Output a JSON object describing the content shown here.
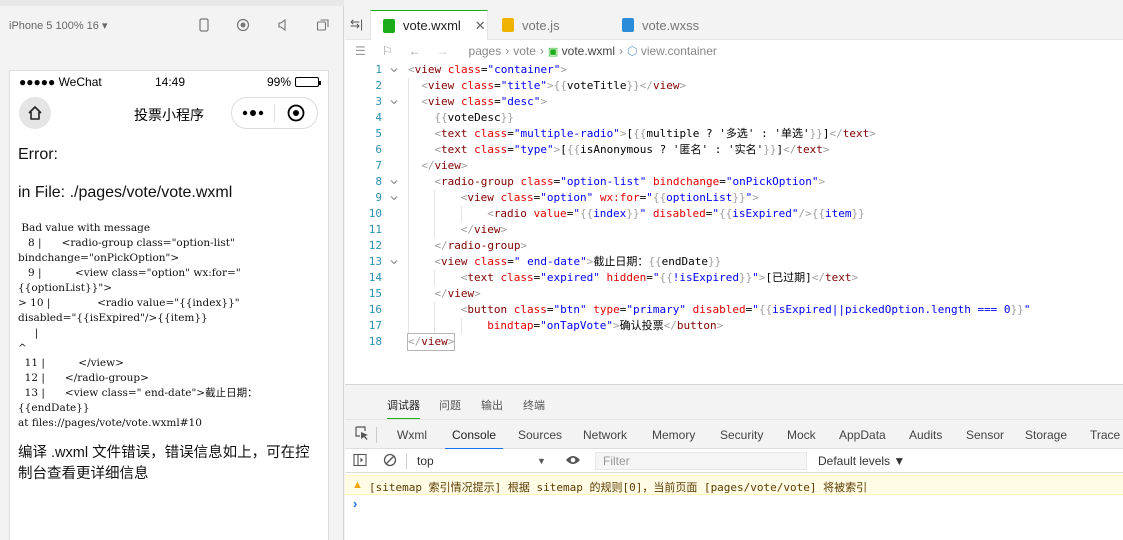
{
  "simulator": {
    "device": "iPhone 5 100% 16 ▾",
    "status": {
      "carrier": "●●●●● WeChat",
      "time": "14:49",
      "battery": "99%",
      "battery_level": 0.99
    },
    "nav_title": "投票小程序",
    "error_title": "Error:",
    "error_file": "in File: ./pages/vote/vote.wxml",
    "error_code": " Bad value with message\n   8 |      <radio-group class=\"option-list\"\nbindchange=\"onPickOption\">\n   9 |          <view class=\"option\" wx:for=\"\n{{optionList}}\">\n> 10 |              <radio value=\"{{index}}\"\ndisabled=\"{{isExpired\"/>{{item}}\n     |\n^\n  11 |          </view>\n  12 |      </radio-group>\n  13 |      <view class=\" end-date\">截止日期：\n{{endDate}}\nat files://pages/vote/vote.wxml#10",
    "error_tip": "编译 .wxml 文件错误，错误信息如上，可在控制台查看更详细信息"
  },
  "editor": {
    "tabs": [
      {
        "label": "vote.wxml",
        "active": true,
        "color": "#1aad19"
      },
      {
        "label": "vote.js",
        "active": false,
        "color": "#f0b400"
      },
      {
        "label": "vote.wxss",
        "active": false,
        "color": "#2b8cd9"
      }
    ],
    "breadcrumb": [
      "pages",
      "vote",
      "vote.wxml",
      "view.container"
    ],
    "lines": [
      {
        "n": "1",
        "fold": true,
        "indent": 0,
        "tokens": [
          [
            "br",
            "<"
          ],
          [
            "tag",
            "view"
          ],
          [
            "t",
            " "
          ],
          [
            "attr",
            "class"
          ],
          [
            "t",
            "="
          ],
          [
            "val",
            "\"container\""
          ],
          [
            "br",
            ">"
          ]
        ]
      },
      {
        "n": "2",
        "fold": false,
        "indent": 1,
        "tokens": [
          [
            "br",
            "<"
          ],
          [
            "tag",
            "view"
          ],
          [
            "t",
            " "
          ],
          [
            "attr",
            "class"
          ],
          [
            "t",
            "="
          ],
          [
            "val",
            "\"title\""
          ],
          [
            "br",
            ">"
          ],
          [
            "br",
            "{{"
          ],
          [
            "t",
            "voteTitle"
          ],
          [
            "br",
            "}}"
          ],
          [
            "br",
            "</"
          ],
          [
            "tag",
            "view"
          ],
          [
            "br",
            ">"
          ]
        ]
      },
      {
        "n": "3",
        "fold": true,
        "indent": 1,
        "tokens": [
          [
            "br",
            "<"
          ],
          [
            "tag",
            "view"
          ],
          [
            "t",
            " "
          ],
          [
            "attr",
            "class"
          ],
          [
            "t",
            "="
          ],
          [
            "val",
            "\"desc\""
          ],
          [
            "br",
            ">"
          ]
        ]
      },
      {
        "n": "4",
        "fold": false,
        "indent": 2,
        "tokens": [
          [
            "br",
            "{{"
          ],
          [
            "t",
            "voteDesc"
          ],
          [
            "br",
            "}}"
          ]
        ]
      },
      {
        "n": "5",
        "fold": false,
        "indent": 2,
        "tokens": [
          [
            "br",
            "<"
          ],
          [
            "tag",
            "text"
          ],
          [
            "t",
            " "
          ],
          [
            "attr",
            "class"
          ],
          [
            "t",
            "="
          ],
          [
            "val",
            "\"multiple-radio\""
          ],
          [
            "br",
            ">"
          ],
          [
            "t",
            "["
          ],
          [
            "br",
            "{{"
          ],
          [
            "t",
            "multiple ? '多选' : '单选'"
          ],
          [
            "br",
            "}}"
          ],
          [
            "t",
            "]"
          ],
          [
            "br",
            "</"
          ],
          [
            "tag",
            "text"
          ],
          [
            "br",
            ">"
          ]
        ]
      },
      {
        "n": "6",
        "fold": false,
        "indent": 2,
        "tokens": [
          [
            "br",
            "<"
          ],
          [
            "tag",
            "text"
          ],
          [
            "t",
            " "
          ],
          [
            "attr",
            "class"
          ],
          [
            "t",
            "="
          ],
          [
            "val",
            "\"type\""
          ],
          [
            "br",
            ">"
          ],
          [
            "t",
            "["
          ],
          [
            "br",
            "{{"
          ],
          [
            "t",
            "isAnonymous ? '匿名' : '实名'"
          ],
          [
            "br",
            "}}"
          ],
          [
            "t",
            "]"
          ],
          [
            "br",
            "</"
          ],
          [
            "tag",
            "text"
          ],
          [
            "br",
            ">"
          ]
        ]
      },
      {
        "n": "7",
        "fold": false,
        "indent": 1,
        "tokens": [
          [
            "br",
            "</"
          ],
          [
            "tag",
            "view"
          ],
          [
            "br",
            ">"
          ]
        ]
      },
      {
        "n": "8",
        "fold": true,
        "indent": 2,
        "tokens": [
          [
            "br",
            "<"
          ],
          [
            "tag",
            "radio-group"
          ],
          [
            "t",
            " "
          ],
          [
            "attr",
            "class"
          ],
          [
            "t",
            "="
          ],
          [
            "val",
            "\"option-list\""
          ],
          [
            "t",
            " "
          ],
          [
            "attr",
            "bindchange"
          ],
          [
            "t",
            "="
          ],
          [
            "val",
            "\"onPickOption\""
          ],
          [
            "br",
            ">"
          ]
        ]
      },
      {
        "n": "9",
        "fold": true,
        "indent": 4,
        "tokens": [
          [
            "br",
            "<"
          ],
          [
            "tag",
            "view"
          ],
          [
            "t",
            " "
          ],
          [
            "attr",
            "class"
          ],
          [
            "t",
            "="
          ],
          [
            "val",
            "\"option\""
          ],
          [
            "t",
            " "
          ],
          [
            "attr",
            "wx:for"
          ],
          [
            "t",
            "="
          ],
          [
            "val",
            "\""
          ],
          [
            "br",
            "{{"
          ],
          [
            "val",
            "optionList"
          ],
          [
            "br",
            "}}"
          ],
          [
            "val",
            "\""
          ],
          [
            "br",
            ">"
          ]
        ]
      },
      {
        "n": "10",
        "fold": false,
        "indent": 6,
        "tokens": [
          [
            "br",
            "<"
          ],
          [
            "tag",
            "radio"
          ],
          [
            "t",
            " "
          ],
          [
            "attr",
            "value"
          ],
          [
            "t",
            "="
          ],
          [
            "val",
            "\""
          ],
          [
            "br",
            "{{"
          ],
          [
            "val",
            "index"
          ],
          [
            "br",
            "}}"
          ],
          [
            "val",
            "\""
          ],
          [
            "t",
            " "
          ],
          [
            "attr",
            "disabled"
          ],
          [
            "t",
            "="
          ],
          [
            "val",
            "\""
          ],
          [
            "br",
            "{{"
          ],
          [
            "val",
            "isExpired"
          ],
          [
            "val",
            "\""
          ],
          [
            "br",
            "/>"
          ],
          [
            "br",
            "{{"
          ],
          [
            "val",
            "item"
          ],
          [
            "br",
            "}}"
          ]
        ]
      },
      {
        "n": "11",
        "fold": false,
        "indent": 4,
        "tokens": [
          [
            "br",
            "</"
          ],
          [
            "tag",
            "view"
          ],
          [
            "br",
            ">"
          ]
        ]
      },
      {
        "n": "12",
        "fold": false,
        "indent": 2,
        "tokens": [
          [
            "br",
            "</"
          ],
          [
            "tag",
            "radio-group"
          ],
          [
            "br",
            ">"
          ]
        ]
      },
      {
        "n": "13",
        "fold": true,
        "indent": 2,
        "tokens": [
          [
            "br",
            "<"
          ],
          [
            "tag",
            "view"
          ],
          [
            "t",
            " "
          ],
          [
            "attr",
            "class"
          ],
          [
            "t",
            "="
          ],
          [
            "val",
            "\" end-date\""
          ],
          [
            "br",
            ">"
          ],
          [
            "t",
            "截止日期："
          ],
          [
            "br",
            "{{"
          ],
          [
            "t",
            "endDate"
          ],
          [
            "br",
            "}}"
          ]
        ]
      },
      {
        "n": "14",
        "fold": false,
        "indent": 4,
        "tokens": [
          [
            "br",
            "<"
          ],
          [
            "tag",
            "text"
          ],
          [
            "t",
            " "
          ],
          [
            "attr",
            "class"
          ],
          [
            "t",
            "="
          ],
          [
            "val",
            "\"expired\""
          ],
          [
            "t",
            " "
          ],
          [
            "attr",
            "hidden"
          ],
          [
            "t",
            "="
          ],
          [
            "val",
            "\""
          ],
          [
            "br",
            "{{"
          ],
          [
            "val",
            "!isExpired"
          ],
          [
            "br",
            "}}"
          ],
          [
            "val",
            "\""
          ],
          [
            "br",
            ">"
          ],
          [
            "t",
            "[已过期]"
          ],
          [
            "br",
            "</"
          ],
          [
            "tag",
            "text"
          ],
          [
            "br",
            ">"
          ]
        ]
      },
      {
        "n": "15",
        "fold": false,
        "indent": 2,
        "tokens": [
          [
            "br",
            "</"
          ],
          [
            "tag",
            "view"
          ],
          [
            "br",
            ">"
          ]
        ]
      },
      {
        "n": "16",
        "fold": false,
        "indent": 4,
        "tokens": [
          [
            "br",
            "<"
          ],
          [
            "tag",
            "button"
          ],
          [
            "t",
            " "
          ],
          [
            "attr",
            "class"
          ],
          [
            "t",
            "="
          ],
          [
            "val",
            "\"btn\""
          ],
          [
            "t",
            " "
          ],
          [
            "attr",
            "type"
          ],
          [
            "t",
            "="
          ],
          [
            "val",
            "\"primary\""
          ],
          [
            "t",
            " "
          ],
          [
            "attr",
            "disabled"
          ],
          [
            "t",
            "="
          ],
          [
            "val",
            "\""
          ],
          [
            "br",
            "{{"
          ],
          [
            "val",
            "isExpired||pickedOption.length === 0"
          ],
          [
            "br",
            "}}"
          ],
          [
            "val",
            "\""
          ]
        ]
      },
      {
        "n": "17",
        "fold": false,
        "indent": 6,
        "tokens": [
          [
            "attr",
            "bindtap"
          ],
          [
            "t",
            "="
          ],
          [
            "val",
            "\"onTapVote\""
          ],
          [
            "br",
            ">"
          ],
          [
            "t",
            "确认投票"
          ],
          [
            "br",
            "</"
          ],
          [
            "tag",
            "button"
          ],
          [
            "br",
            ">"
          ]
        ]
      },
      {
        "n": "18",
        "fold": false,
        "indent": 0,
        "tokens": [
          [
            "br",
            "</"
          ],
          [
            "tag",
            "view"
          ],
          [
            "br",
            ">"
          ]
        ]
      }
    ]
  },
  "devtools": {
    "top_tabs": [
      "调试器",
      "问题",
      "输出",
      "终端"
    ],
    "panel_tabs": [
      "Wxml",
      "Console",
      "Sources",
      "Network",
      "Memory",
      "Security",
      "Mock",
      "AppData",
      "Audits",
      "Sensor",
      "Storage",
      "Trace"
    ],
    "active_panel": "Console",
    "context": "top",
    "filter_placeholder": "Filter",
    "levels": "Default levels ▼",
    "warning": "[sitemap 索引情况提示] 根据 sitemap 的规则[0]，当前页面 [pages/vote/vote] 将被索引",
    "prompt": "›"
  }
}
